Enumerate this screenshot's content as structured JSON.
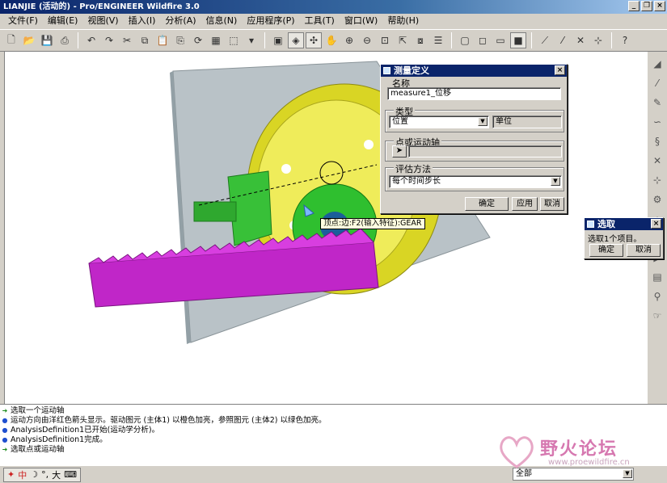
{
  "window": {
    "title": "LIANJIE (活动的) - Pro/ENGINEER Wildfire 3.0"
  },
  "menubar": {
    "items": [
      "文件(F)",
      "编辑(E)",
      "视图(V)",
      "插入(I)",
      "分析(A)",
      "信息(N)",
      "应用程序(P)",
      "工具(T)",
      "窗口(W)",
      "帮助(H)"
    ]
  },
  "viewport": {
    "tooltip": "顶点:边:F2(输入特征):GEAR"
  },
  "measure_dialog": {
    "title": "测量定义",
    "name_label": "名称",
    "name_value": "measure1_位移",
    "type_label": "类型",
    "type_value": "位置",
    "unit_value": "单位",
    "point_label": "点或运动轴",
    "method_label": "评估方法",
    "method_value": "每个时间步长",
    "ok_label": "确定",
    "apply_label": "应用",
    "cancel_label": "取消"
  },
  "select_dialog": {
    "title": "选取",
    "message": "选取1个项目。",
    "ok_label": "确定",
    "cancel_label": "取消"
  },
  "messages": [
    {
      "icon": "arrow",
      "text": "选取一个运动轴"
    },
    {
      "icon": "bullet",
      "text": "运动方向由洋红色箭头显示。驱动图元 (主体1) 以橙色加亮，参照图元 (主体2) 以绿色加亮。"
    },
    {
      "icon": "bullet",
      "text": "AnalysisDefinition1已开始(运动学分析)。"
    },
    {
      "icon": "bullet",
      "text": "AnalysisDefinition1完成。"
    },
    {
      "icon": "arrow",
      "text": "选取点或运动轴"
    }
  ],
  "statusbar": {
    "ime_mode": "中",
    "ime_width": "大",
    "filter_value": "全部"
  },
  "watermark": {
    "brand": "野火论坛",
    "site": "www.proewildfire.cn"
  },
  "colors": {
    "title_blue": "#0a246a",
    "gear_yellow": "#e8e62a",
    "gear_green": "#2fbf2f",
    "rack_magenta": "#c026c8",
    "plate_gray": "#b9c2c7"
  }
}
